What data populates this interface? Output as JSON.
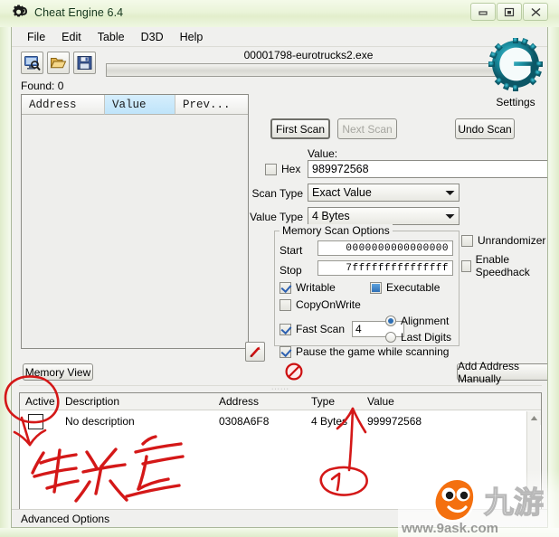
{
  "window": {
    "title": "Cheat Engine 6.4",
    "logo_icon": "cheat-engine-gear-icon",
    "controls": [
      {
        "name": "minimize",
        "icon": "minimize-icon"
      },
      {
        "name": "maximize",
        "icon": "maximize-icon"
      },
      {
        "name": "close",
        "icon": "close-icon"
      }
    ]
  },
  "menubar": {
    "items": [
      {
        "label": "File"
      },
      {
        "label": "Edit"
      },
      {
        "label": "Table"
      },
      {
        "label": "D3D"
      },
      {
        "label": "Help"
      }
    ]
  },
  "toolbar": {
    "buttons": [
      {
        "name": "open-process-button",
        "icon": "process-select-icon"
      },
      {
        "name": "open-file-button",
        "icon": "folder-open-icon"
      },
      {
        "name": "save-file-button",
        "icon": "floppy-save-icon"
      }
    ]
  },
  "process": {
    "name": "00001798-eurotrucks2.exe",
    "progress_percent": 0
  },
  "found": {
    "label": "Found: 0"
  },
  "results": {
    "columns": [
      {
        "label": "Address",
        "highlighted": false
      },
      {
        "label": "Value",
        "highlighted": true
      },
      {
        "label": "Prev...",
        "highlighted": false
      }
    ],
    "rows": []
  },
  "branding": {
    "logo_icon": "cheat-engine-logo-icon",
    "settings_label": "Settings"
  },
  "scan": {
    "first_scan_label": "First Scan",
    "next_scan_label": "Next Scan",
    "next_scan_disabled": true,
    "undo_scan_label": "Undo Scan",
    "value_label": "Value:",
    "hex_label": "Hex",
    "hex_checked": false,
    "value": "989972568",
    "scan_type_label": "Scan Type",
    "scan_type_value": "Exact Value",
    "value_type_label": "Value Type",
    "value_type_value": "4 Bytes"
  },
  "memory_scan_options": {
    "title": "Memory Scan Options",
    "start_label": "Start",
    "start_value": "0000000000000000",
    "stop_label": "Stop",
    "stop_value": "7fffffffffffffff",
    "writable_label": "Writable",
    "writable_checked": true,
    "executable_label": "Executable",
    "executable_state": "filled",
    "copyonwrite_label": "CopyOnWrite",
    "copyonwrite_checked": false,
    "fast_scan_label": "Fast Scan",
    "fast_scan_checked": true,
    "fast_scan_value": "4",
    "alignment_label": "Alignment",
    "alignment_selected": true,
    "last_digits_label": "Last Digits",
    "last_digits_selected": false,
    "pause_label": "Pause the game while scanning",
    "pause_checked": true
  },
  "extra_options": {
    "unrandomizer_label": "Unrandomizer",
    "unrandomizer_checked": false,
    "speedhack_label": "Enable Speedhack",
    "speedhack_checked": false
  },
  "bottom_bar": {
    "memory_view_label": "Memory View",
    "stop_icon": "stop-prohibited-icon",
    "add_address_label": "Add Address Manually",
    "red_arrow_icon": "red-arrow-icon"
  },
  "cheat_table": {
    "columns": [
      "Active",
      "Description",
      "Address",
      "Type",
      "Value"
    ],
    "rows": [
      {
        "active": false,
        "description": "No description",
        "address": "0308A6F8",
        "type": "4 Bytes",
        "value": "999972568"
      }
    ],
    "scrollbar_icon": "scroll-up-arrow-icon"
  },
  "statusbar": {
    "advanced_options_label": "Advanced Options"
  },
  "annotations": {
    "handwriting_color": "#d41818",
    "lock_text": "锁定",
    "circled_number": "1",
    "marks": [
      {
        "name": "circle-around-active-checkbox",
        "target": "active-checkbox"
      },
      {
        "name": "arrow-to-active-checkbox",
        "target": "active-checkbox"
      },
      {
        "name": "handwritten-lock-label",
        "text": "锁定"
      },
      {
        "name": "arrow-to-value-cell",
        "target": "cheat-table-value"
      },
      {
        "name": "circled-step-number",
        "text": "1"
      }
    ]
  },
  "watermark": {
    "brand_text": "九游",
    "url_text": "www.9ask.com",
    "accent_color": "#f4700f"
  }
}
